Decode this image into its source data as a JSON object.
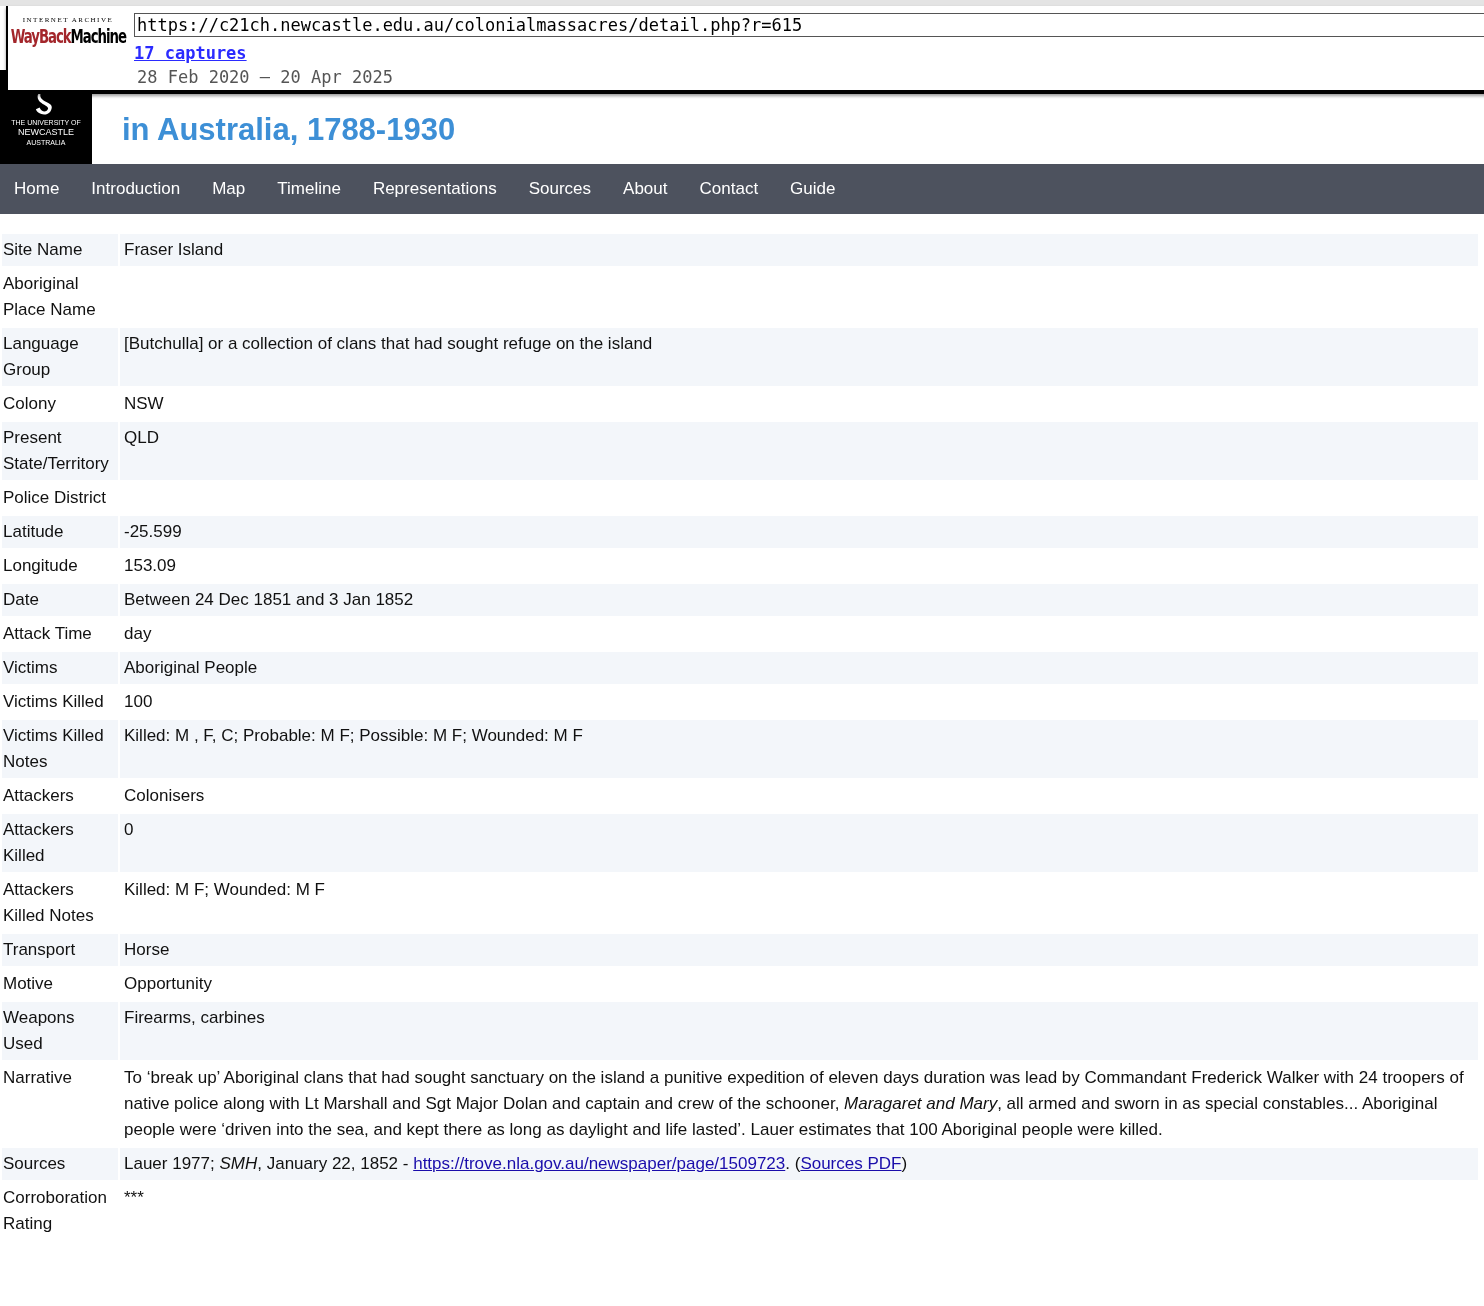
{
  "wayback": {
    "brand_top": "INTERNET ARCHIVE",
    "brand_wayback": "WayBack",
    "brand_machine": "Machine",
    "url": "https://c21ch.newcastle.edu.au/colonialmassacres/detail.php?r=615",
    "captures": "17 captures",
    "range": "28 Feb 2020 – 20 Apr 2025"
  },
  "logo": {
    "line1": "THE UNIVERSITY OF",
    "line2": "NEWCASTLE",
    "line3": "AUSTRALIA"
  },
  "title": [
    "in Australia, 1788-1930"
  ],
  "nav": [
    "Home",
    "Introduction",
    "Map",
    "Timeline",
    "Representations",
    "Sources",
    "About",
    "Contact",
    "Guide"
  ],
  "rows": [
    {
      "label": "Site Name",
      "value": "Fraser Island"
    },
    {
      "label": "Aboriginal Place Name",
      "value": ""
    },
    {
      "label": "Language Group",
      "value": "[Butchulla] or a collection of clans that had sought refuge on the island"
    },
    {
      "label": "Colony",
      "value": "NSW"
    },
    {
      "label": "Present State/Territory",
      "value": "QLD"
    },
    {
      "label": "Police District",
      "value": ""
    },
    {
      "label": "Latitude",
      "value": "-25.599"
    },
    {
      "label": "Longitude",
      "value": "153.09"
    },
    {
      "label": "Date",
      "value": "Between 24 Dec 1851 and 3 Jan 1852"
    },
    {
      "label": "Attack Time",
      "value": "day"
    },
    {
      "label": "Victims",
      "value": "Aboriginal People"
    },
    {
      "label": "Victims Killed",
      "value": "100"
    },
    {
      "label": "Victims Killed Notes",
      "value": "Killed: M , F, C; Probable: M F; Possible: M F; Wounded: M F"
    },
    {
      "label": "Attackers",
      "value": "Colonisers"
    },
    {
      "label": "Attackers Killed",
      "value": "0"
    },
    {
      "label": "Attackers Killed Notes",
      "value": "Killed: M F; Wounded: M F"
    },
    {
      "label": "Transport",
      "value": "Horse"
    },
    {
      "label": "Motive",
      "value": "Opportunity"
    },
    {
      "label": "Weapons Used",
      "value": "Firearms, carbines"
    },
    {
      "label": "Narrative",
      "value": "To ‘break up’ Aboriginal clans that had sought sanctuary on the island a punitive expedition of eleven days duration was lead by Commandant Frederick Walker with 24 troopers of native police along with Lt Marshall and Sgt Major Dolan and captain and crew of the schooner, *Maragaret and Mary*, all armed and sworn in as special constables... Aboriginal people were ‘driven into the sea, and kept there as long as daylight and life lasted’. Lauer estimates that 100 Aboriginal people were killed."
    },
    {
      "label": "Sources",
      "parts": [
        {
          "kind": "text",
          "text": "Lauer 1977; *SMH*, January 22, 1852 - "
        },
        {
          "kind": "link",
          "text": "https://trove.nla.gov.au/newspaper/page/1509723"
        },
        {
          "kind": "text",
          "text": ". ("
        },
        {
          "kind": "link",
          "text": "Sources PDF"
        },
        {
          "kind": "text",
          "text": ")"
        }
      ]
    },
    {
      "label": "Corroboration Rating",
      "value": "***"
    }
  ]
}
